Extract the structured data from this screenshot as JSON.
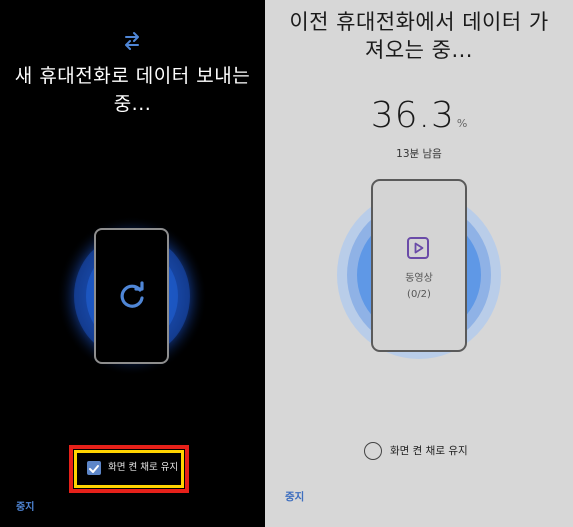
{
  "left": {
    "title": "새 휴대전화로 데이터 보내는 중...",
    "keep_screen_label": "화면 켠 채로 유지",
    "keep_screen_checked": true,
    "stop_label": "중지",
    "icons": {
      "top": "swap-arrows-icon",
      "center": "refresh-icon"
    },
    "colors": {
      "accent": "#4f86d6",
      "highlight_outer": "#e7211a",
      "highlight_inner": "#ffd400"
    }
  },
  "right": {
    "title": "이전 휴대전화에서 데이터 가져오는 중...",
    "progress_value": "36.3",
    "progress_unit": "%",
    "remaining": "13분 남음",
    "category_label": "동영상",
    "category_count": "(0/2)",
    "keep_screen_label": "화면 켠 채로 유지",
    "keep_screen_checked": false,
    "stop_label": "중지",
    "icons": {
      "center": "video-icon"
    },
    "colors": {
      "accent": "#3f6fbf",
      "icon": "#6a4ba8"
    }
  }
}
